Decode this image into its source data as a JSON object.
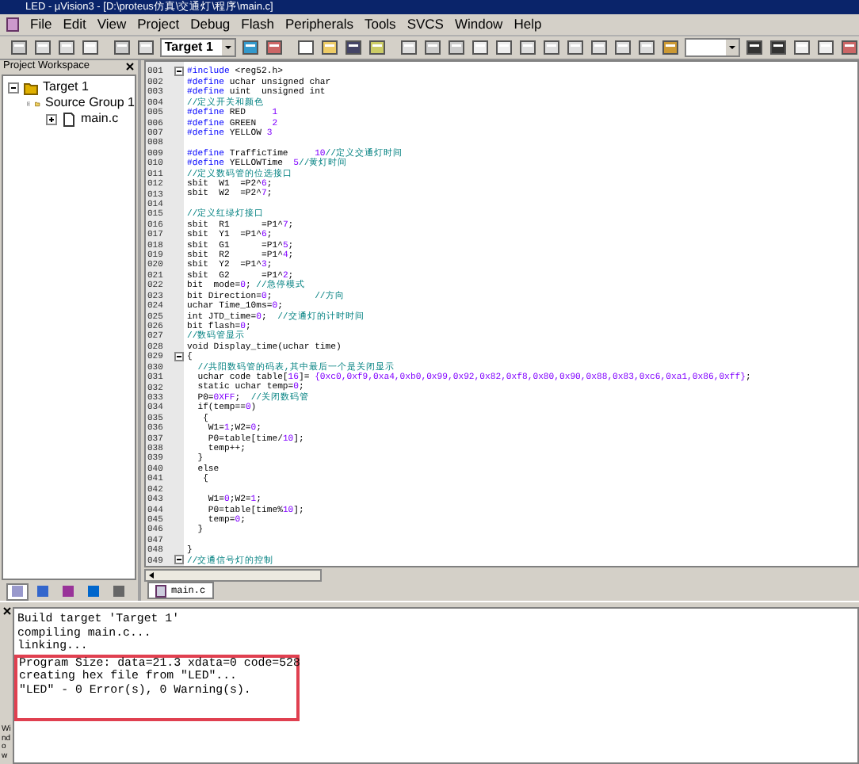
{
  "window": {
    "title": "LED - µVision3 - [D:\\proteus仿真\\交通灯\\程序\\main.c]"
  },
  "menu": [
    "File",
    "Edit",
    "View",
    "Project",
    "Debug",
    "Flash",
    "Peripherals",
    "Tools",
    "SVCS",
    "Window",
    "Help"
  ],
  "toolbar": {
    "target": "Target 1"
  },
  "workspace": {
    "title": "Project Workspace",
    "tree": [
      {
        "label": "Target 1",
        "kind": "target",
        "children": [
          {
            "label": "Source Group 1",
            "kind": "group",
            "children": [
              {
                "label": "main.c",
                "kind": "file"
              }
            ]
          }
        ]
      }
    ],
    "tabs": [
      {
        "kind": "files",
        "selected": true
      },
      {
        "kind": "regs",
        "selected": false
      },
      {
        "kind": "books",
        "selected": false
      },
      {
        "kind": "functions",
        "selected": false
      },
      {
        "kind": "templates",
        "selected": false
      }
    ]
  },
  "editor": {
    "lines": [
      {
        "no": "001",
        "fold": true,
        "segments": [
          {
            "kind": "keyword",
            "text": "#include"
          },
          {
            "kind": "plain",
            "text": " <reg52.h>"
          }
        ]
      },
      {
        "no": "002",
        "segments": [
          {
            "kind": "keyword",
            "text": "#define"
          },
          {
            "kind": "plain",
            "text": " uchar unsigned char"
          }
        ]
      },
      {
        "no": "003",
        "segments": [
          {
            "kind": "keyword",
            "text": "#define"
          },
          {
            "kind": "plain",
            "text": " uint  unsigned int"
          }
        ]
      },
      {
        "no": "004",
        "segments": [
          {
            "kind": "comment",
            "text": "//定义开关和颜色"
          }
        ]
      },
      {
        "no": "005",
        "segments": [
          {
            "kind": "keyword",
            "text": "#define"
          },
          {
            "kind": "plain",
            "text": " RED     "
          },
          {
            "kind": "number",
            "text": "1"
          }
        ]
      },
      {
        "no": "006",
        "segments": [
          {
            "kind": "keyword",
            "text": "#define"
          },
          {
            "kind": "plain",
            "text": " GREEN   "
          },
          {
            "kind": "number",
            "text": "2"
          }
        ]
      },
      {
        "no": "007",
        "segments": [
          {
            "kind": "keyword",
            "text": "#define"
          },
          {
            "kind": "plain",
            "text": " YELLOW "
          },
          {
            "kind": "number",
            "text": "3"
          }
        ]
      },
      {
        "no": "008"
      },
      {
        "no": "009",
        "segments": [
          {
            "kind": "keyword",
            "text": "#define"
          },
          {
            "kind": "plain",
            "text": " TrafficTime     "
          },
          {
            "kind": "number",
            "text": "10"
          },
          {
            "kind": "comment",
            "text": "//定义交通灯时间"
          }
        ]
      },
      {
        "no": "010",
        "segments": [
          {
            "kind": "keyword",
            "text": "#define"
          },
          {
            "kind": "plain",
            "text": " YELLOWTime  "
          },
          {
            "kind": "number",
            "text": "5"
          },
          {
            "kind": "comment",
            "text": "//黄灯时间"
          }
        ]
      },
      {
        "no": "011",
        "segments": [
          {
            "kind": "comment",
            "text": "//定义数码管的位选接口"
          }
        ]
      },
      {
        "no": "012",
        "segments": [
          {
            "kind": "plain",
            "text": "sbit  W1  =P2^"
          },
          {
            "kind": "number",
            "text": "6"
          },
          {
            "kind": "plain",
            "text": ";"
          }
        ]
      },
      {
        "no": "013",
        "segments": [
          {
            "kind": "plain",
            "text": "sbit  W2  =P2^"
          },
          {
            "kind": "number",
            "text": "7"
          },
          {
            "kind": "plain",
            "text": ";"
          }
        ]
      },
      {
        "no": "014"
      },
      {
        "no": "015",
        "segments": [
          {
            "kind": "comment",
            "text": "//定义红绿灯接口"
          }
        ]
      },
      {
        "no": "016",
        "segments": [
          {
            "kind": "plain",
            "text": "sbit  R1      =P1^"
          },
          {
            "kind": "number",
            "text": "7"
          },
          {
            "kind": "plain",
            "text": ";"
          }
        ]
      },
      {
        "no": "017",
        "segments": [
          {
            "kind": "plain",
            "text": "sbit  Y1  =P1^"
          },
          {
            "kind": "number",
            "text": "6"
          },
          {
            "kind": "plain",
            "text": ";"
          }
        ]
      },
      {
        "no": "018",
        "segments": [
          {
            "kind": "plain",
            "text": "sbit  G1      =P1^"
          },
          {
            "kind": "number",
            "text": "5"
          },
          {
            "kind": "plain",
            "text": ";"
          }
        ]
      },
      {
        "no": "019",
        "segments": [
          {
            "kind": "plain",
            "text": "sbit  R2      =P1^"
          },
          {
            "kind": "number",
            "text": "4"
          },
          {
            "kind": "plain",
            "text": ";"
          }
        ]
      },
      {
        "no": "020",
        "segments": [
          {
            "kind": "plain",
            "text": "sbit  Y2  =P1^"
          },
          {
            "kind": "number",
            "text": "3"
          },
          {
            "kind": "plain",
            "text": ";"
          }
        ]
      },
      {
        "no": "021",
        "segments": [
          {
            "kind": "plain",
            "text": "sbit  G2      =P1^"
          },
          {
            "kind": "number",
            "text": "2"
          },
          {
            "kind": "plain",
            "text": ";"
          }
        ]
      },
      {
        "no": "022",
        "segments": [
          {
            "kind": "plain",
            "text": "bit  mode="
          },
          {
            "kind": "number",
            "text": "0"
          },
          {
            "kind": "plain",
            "text": "; "
          },
          {
            "kind": "comment",
            "text": "//急停模式"
          }
        ]
      },
      {
        "no": "023",
        "segments": [
          {
            "kind": "plain",
            "text": "bit Direction="
          },
          {
            "kind": "number",
            "text": "0"
          },
          {
            "kind": "plain",
            "text": ";        "
          },
          {
            "kind": "comment",
            "text": "//方向"
          }
        ]
      },
      {
        "no": "024",
        "segments": [
          {
            "kind": "plain",
            "text": "uchar Time_10ms="
          },
          {
            "kind": "number",
            "text": "0"
          },
          {
            "kind": "plain",
            "text": ";"
          }
        ]
      },
      {
        "no": "025",
        "segments": [
          {
            "kind": "plain",
            "text": "int JTD_time="
          },
          {
            "kind": "number",
            "text": "0"
          },
          {
            "kind": "plain",
            "text": ";  "
          },
          {
            "kind": "comment",
            "text": "//交通灯的计时时间"
          }
        ]
      },
      {
        "no": "026",
        "segments": [
          {
            "kind": "plain",
            "text": "bit flash="
          },
          {
            "kind": "number",
            "text": "0"
          },
          {
            "kind": "plain",
            "text": ";"
          }
        ]
      },
      {
        "no": "027",
        "segments": [
          {
            "kind": "comment",
            "text": "//数码管显示"
          }
        ]
      },
      {
        "no": "028",
        "segments": [
          {
            "kind": "plain",
            "text": "void Display_time(uchar time)"
          }
        ]
      },
      {
        "no": "029",
        "fold": true,
        "segments": [
          {
            "kind": "plain",
            "text": "{"
          }
        ]
      },
      {
        "no": "030",
        "segments": [
          {
            "kind": "comment",
            "text": "  //共阳数码管的码表,其中最后一个是关闭显示"
          }
        ]
      },
      {
        "no": "031",
        "segments": [
          {
            "kind": "plain",
            "text": "  uchar code table["
          },
          {
            "kind": "number",
            "text": "16"
          },
          {
            "kind": "plain",
            "text": "]= "
          },
          {
            "kind": "number",
            "text": "{0xc0,0xf9,0xa4,0xb0,0x99,0x92,0x82,0xf8,0x80,0x90,0x88,0x83,0xc6,0xa1,0x86,0xff}"
          },
          {
            "kind": "plain",
            "text": ";"
          }
        ]
      },
      {
        "no": "032",
        "segments": [
          {
            "kind": "plain",
            "text": "  static uchar temp="
          },
          {
            "kind": "number",
            "text": "0"
          },
          {
            "kind": "plain",
            "text": ";"
          }
        ]
      },
      {
        "no": "033",
        "segments": [
          {
            "kind": "plain",
            "text": "  P0="
          },
          {
            "kind": "number",
            "text": "0XFF"
          },
          {
            "kind": "plain",
            "text": ";  "
          },
          {
            "kind": "comment",
            "text": "//关闭数码管"
          }
        ]
      },
      {
        "no": "034",
        "segments": [
          {
            "kind": "plain",
            "text": "  if(temp=="
          },
          {
            "kind": "number",
            "text": "0"
          },
          {
            "kind": "plain",
            "text": ")"
          }
        ]
      },
      {
        "no": "035",
        "segments": [
          {
            "kind": "plain",
            "text": "   {"
          }
        ]
      },
      {
        "no": "036",
        "segments": [
          {
            "kind": "plain",
            "text": "    W1="
          },
          {
            "kind": "number",
            "text": "1"
          },
          {
            "kind": "plain",
            "text": ";W2="
          },
          {
            "kind": "number",
            "text": "0"
          },
          {
            "kind": "plain",
            "text": ";"
          }
        ]
      },
      {
        "no": "037",
        "segments": [
          {
            "kind": "plain",
            "text": "    P0=table[time/"
          },
          {
            "kind": "number",
            "text": "10"
          },
          {
            "kind": "plain",
            "text": "];"
          }
        ]
      },
      {
        "no": "038",
        "segments": [
          {
            "kind": "plain",
            "text": "    temp++;"
          }
        ]
      },
      {
        "no": "039",
        "segments": [
          {
            "kind": "plain",
            "text": "  }"
          }
        ]
      },
      {
        "no": "040",
        "segments": [
          {
            "kind": "plain",
            "text": "  else"
          }
        ]
      },
      {
        "no": "041",
        "segments": [
          {
            "kind": "plain",
            "text": "   {"
          }
        ]
      },
      {
        "no": "042"
      },
      {
        "no": "043",
        "segments": [
          {
            "kind": "plain",
            "text": "    W1="
          },
          {
            "kind": "number",
            "text": "0"
          },
          {
            "kind": "plain",
            "text": ";W2="
          },
          {
            "kind": "number",
            "text": "1"
          },
          {
            "kind": "plain",
            "text": ";"
          }
        ]
      },
      {
        "no": "044",
        "segments": [
          {
            "kind": "plain",
            "text": "    P0=table[time%"
          },
          {
            "kind": "number",
            "text": "10"
          },
          {
            "kind": "plain",
            "text": "];"
          }
        ]
      },
      {
        "no": "045",
        "segments": [
          {
            "kind": "plain",
            "text": "    temp="
          },
          {
            "kind": "number",
            "text": "0"
          },
          {
            "kind": "plain",
            "text": ";"
          }
        ]
      },
      {
        "no": "046",
        "segments": [
          {
            "kind": "plain",
            "text": "  }"
          }
        ]
      },
      {
        "no": "047"
      },
      {
        "no": "048",
        "segments": [
          {
            "kind": "plain",
            "text": "}"
          }
        ]
      },
      {
        "no": "049",
        "fold": true,
        "segments": [
          {
            "kind": "comment",
            "text": "//交通信号灯的控制"
          }
        ]
      }
    ],
    "tabs": [
      {
        "label": "main.c",
        "selected": true
      }
    ]
  },
  "output": {
    "side_label": "Window",
    "lines": [
      {
        "text": "Build target 'Target 1'",
        "highlighted": false
      },
      {
        "text": "compiling main.c...",
        "highlighted": false
      },
      {
        "text": "linking...",
        "highlighted": false
      },
      {
        "text": "Program Size: data=21.3 xdata=0 code=528",
        "highlighted": true
      },
      {
        "text": "creating hex file from \"LED\"...",
        "highlighted": true
      },
      {
        "text": "\"LED\" - 0 Error(s), 0 Warning(s).",
        "highlighted": true
      }
    ]
  }
}
